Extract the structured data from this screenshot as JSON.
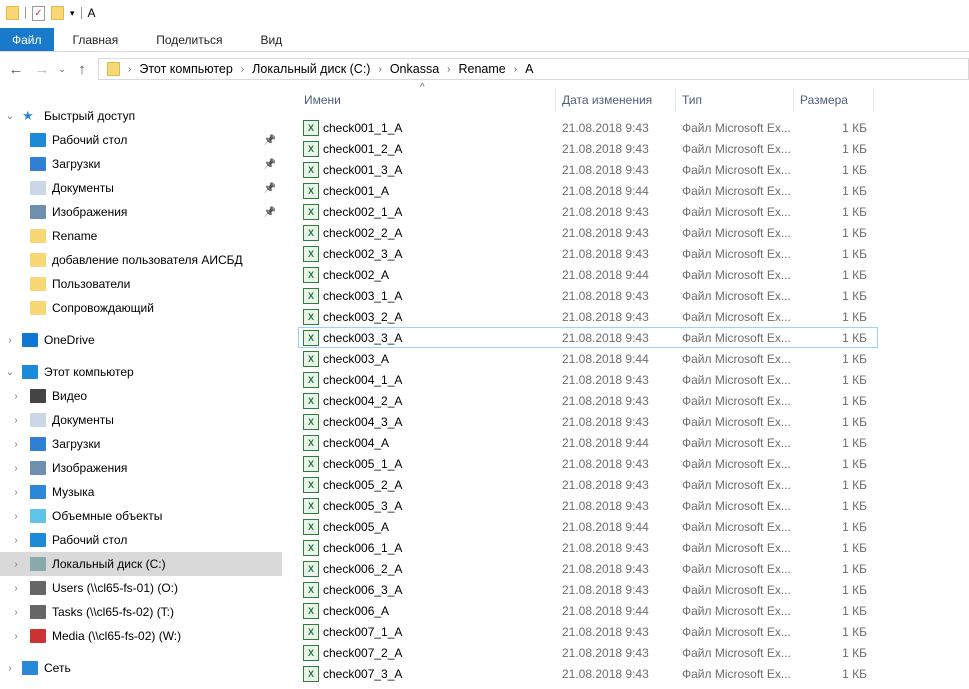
{
  "window": {
    "title": "A"
  },
  "ribbon": {
    "tabs": [
      "Файл",
      "Главная",
      "Поделиться",
      "Вид"
    ]
  },
  "address": {
    "crumbs": [
      "Этот компьютер",
      "Локальный диск (C:)",
      "Onkassa",
      "Rename",
      "A"
    ]
  },
  "sidebar": {
    "items": [
      {
        "label": "Быстрый доступ",
        "icon": "star-icon",
        "color": "#2b88d8",
        "level": 0,
        "expand": "open"
      },
      {
        "label": "Рабочий стол",
        "icon": "desktop-icon",
        "color": "#1b8ad8",
        "level": 1,
        "pin": true
      },
      {
        "label": "Загрузки",
        "icon": "download-icon",
        "color": "#2f7fd6",
        "level": 1,
        "pin": true
      },
      {
        "label": "Документы",
        "icon": "documents-icon",
        "color": "#c9d7e6",
        "level": 1,
        "pin": true
      },
      {
        "label": "Изображения",
        "icon": "pictures-icon",
        "color": "#6e8fb0",
        "level": 1,
        "pin": true
      },
      {
        "label": "Rename",
        "icon": "folder-icon",
        "color": "#f8d775",
        "level": 1
      },
      {
        "label": "добавление пользователя АИСБД",
        "icon": "folder-icon",
        "color": "#f8d775",
        "level": 1
      },
      {
        "label": "Пользователи",
        "icon": "folder-icon",
        "color": "#f8d775",
        "level": 1
      },
      {
        "label": "Сопровождающий",
        "icon": "folder-icon",
        "color": "#f8d775",
        "level": 1
      },
      {
        "label": "",
        "spacer": true
      },
      {
        "label": "OneDrive",
        "icon": "cloud-icon",
        "color": "#0f78d4",
        "level": 0,
        "expand": "closed"
      },
      {
        "label": "",
        "spacer": true
      },
      {
        "label": "Этот компьютер",
        "icon": "computer-icon",
        "color": "#1b8ad8",
        "level": 0,
        "expand": "open"
      },
      {
        "label": "Видео",
        "icon": "video-icon",
        "color": "#444",
        "level": 1,
        "expand": "closed"
      },
      {
        "label": "Документы",
        "icon": "documents-icon",
        "color": "#c9d7e6",
        "level": 1,
        "expand": "closed"
      },
      {
        "label": "Загрузки",
        "icon": "download-icon",
        "color": "#2f7fd6",
        "level": 1,
        "expand": "closed"
      },
      {
        "label": "Изображения",
        "icon": "pictures-icon",
        "color": "#6e8fb0",
        "level": 1,
        "expand": "closed"
      },
      {
        "label": "Музыка",
        "icon": "music-icon",
        "color": "#2b88d8",
        "level": 1,
        "expand": "closed"
      },
      {
        "label": "Объемные объекты",
        "icon": "3d-objects-icon",
        "color": "#5fc4e8",
        "level": 1,
        "expand": "closed"
      },
      {
        "label": "Рабочий стол",
        "icon": "desktop-icon",
        "color": "#1b8ad8",
        "level": 1,
        "expand": "closed"
      },
      {
        "label": "Локальный диск (C:)",
        "icon": "drive-icon",
        "color": "#8aa",
        "level": 1,
        "expand": "closed",
        "selected": true
      },
      {
        "label": "Users (\\\\cl65-fs-01) (O:)",
        "icon": "network-drive-icon",
        "color": "#666",
        "level": 1,
        "expand": "closed"
      },
      {
        "label": "Tasks (\\\\cl65-fs-02) (T:)",
        "icon": "network-drive-icon",
        "color": "#666",
        "level": 1,
        "expand": "closed"
      },
      {
        "label": "Media (\\\\cl65-fs-02) (W:)",
        "icon": "disconnected-drive-icon",
        "color": "#c33",
        "level": 1,
        "expand": "closed"
      },
      {
        "label": "",
        "spacer": true
      },
      {
        "label": "Сеть",
        "icon": "network-icon",
        "color": "#2b88d8",
        "level": 0,
        "expand": "closed"
      }
    ]
  },
  "columns": [
    "Имени",
    "Дата изменения",
    "Тип",
    "Размера"
  ],
  "files": [
    {
      "name": "check001_1_A",
      "date": "21.08.2018 9:43",
      "type": "Файл Microsoft Ex...",
      "size": "1 КБ"
    },
    {
      "name": "check001_2_A",
      "date": "21.08.2018 9:43",
      "type": "Файл Microsoft Ex...",
      "size": "1 КБ"
    },
    {
      "name": "check001_3_A",
      "date": "21.08.2018 9:43",
      "type": "Файл Microsoft Ex...",
      "size": "1 КБ"
    },
    {
      "name": "check001_A",
      "date": "21.08.2018 9:44",
      "type": "Файл Microsoft Ex...",
      "size": "1 КБ"
    },
    {
      "name": "check002_1_A",
      "date": "21.08.2018 9:43",
      "type": "Файл Microsoft Ex...",
      "size": "1 КБ"
    },
    {
      "name": "check002_2_A",
      "date": "21.08.2018 9:43",
      "type": "Файл Microsoft Ex...",
      "size": "1 КБ"
    },
    {
      "name": "check002_3_A",
      "date": "21.08.2018 9:43",
      "type": "Файл Microsoft Ex...",
      "size": "1 КБ"
    },
    {
      "name": "check002_A",
      "date": "21.08.2018 9:44",
      "type": "Файл Microsoft Ex...",
      "size": "1 КБ"
    },
    {
      "name": "check003_1_A",
      "date": "21.08.2018 9:43",
      "type": "Файл Microsoft Ex...",
      "size": "1 КБ"
    },
    {
      "name": "check003_2_A",
      "date": "21.08.2018 9:43",
      "type": "Файл Microsoft Ex...",
      "size": "1 КБ"
    },
    {
      "name": "check003_3_A",
      "date": "21.08.2018 9:43",
      "type": "Файл Microsoft Ex...",
      "size": "1 КБ",
      "hover": true
    },
    {
      "name": "check003_A",
      "date": "21.08.2018 9:44",
      "type": "Файл Microsoft Ex...",
      "size": "1 КБ"
    },
    {
      "name": "check004_1_A",
      "date": "21.08.2018 9:43",
      "type": "Файл Microsoft Ex...",
      "size": "1 КБ"
    },
    {
      "name": "check004_2_A",
      "date": "21.08.2018 9:43",
      "type": "Файл Microsoft Ex...",
      "size": "1 КБ"
    },
    {
      "name": "check004_3_A",
      "date": "21.08.2018 9:43",
      "type": "Файл Microsoft Ex...",
      "size": "1 КБ"
    },
    {
      "name": "check004_A",
      "date": "21.08.2018 9:44",
      "type": "Файл Microsoft Ex...",
      "size": "1 КБ"
    },
    {
      "name": "check005_1_A",
      "date": "21.08.2018 9:43",
      "type": "Файл Microsoft Ex...",
      "size": "1 КБ"
    },
    {
      "name": "check005_2_A",
      "date": "21.08.2018 9:43",
      "type": "Файл Microsoft Ex...",
      "size": "1 КБ"
    },
    {
      "name": "check005_3_A",
      "date": "21.08.2018 9:43",
      "type": "Файл Microsoft Ex...",
      "size": "1 КБ"
    },
    {
      "name": "check005_A",
      "date": "21.08.2018 9:44",
      "type": "Файл Microsoft Ex...",
      "size": "1 КБ"
    },
    {
      "name": "check006_1_A",
      "date": "21.08.2018 9:43",
      "type": "Файл Microsoft Ex...",
      "size": "1 КБ"
    },
    {
      "name": "check006_2_A",
      "date": "21.08.2018 9:43",
      "type": "Файл Microsoft Ex...",
      "size": "1 КБ"
    },
    {
      "name": "check006_3_A",
      "date": "21.08.2018 9:43",
      "type": "Файл Microsoft Ex...",
      "size": "1 КБ"
    },
    {
      "name": "check006_A",
      "date": "21.08.2018 9:44",
      "type": "Файл Microsoft Ex...",
      "size": "1 КБ"
    },
    {
      "name": "check007_1_A",
      "date": "21.08.2018 9:43",
      "type": "Файл Microsoft Ex...",
      "size": "1 КБ"
    },
    {
      "name": "check007_2_A",
      "date": "21.08.2018 9:43",
      "type": "Файл Microsoft Ex...",
      "size": "1 КБ"
    },
    {
      "name": "check007_3_A",
      "date": "21.08.2018 9:43",
      "type": "Файл Microsoft Ex...",
      "size": "1 КБ"
    }
  ]
}
